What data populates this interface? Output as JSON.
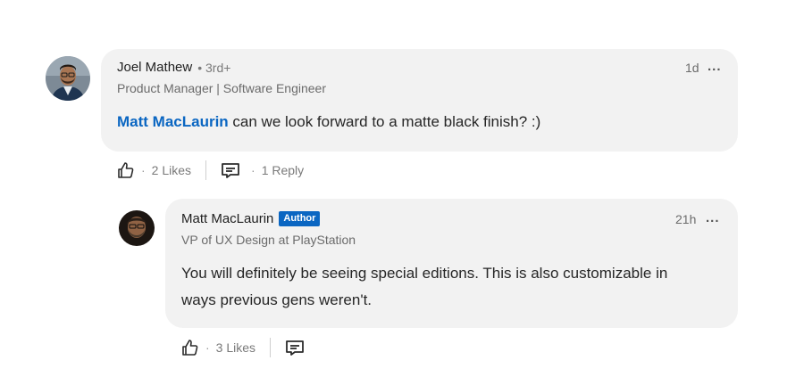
{
  "comment": {
    "author_name": "Joel Mathew",
    "connection_degree": "• 3rd+",
    "headline": "Product Manager | Software Engineer",
    "timestamp": "1d",
    "more_label": "...",
    "mention": "Matt MacLaurin",
    "text": "can we look forward to a matte black finish? :)",
    "like_icon": "thumbs-up-icon",
    "likes": "2 Likes",
    "reply_icon": "comment-reply-icon",
    "replies": "1 Reply",
    "separator_dot": "·"
  },
  "reply": {
    "author_name": "Matt MacLaurin",
    "badge": "Author",
    "headline": "VP of UX Design at PlayStation",
    "timestamp": "21h",
    "more_label": "...",
    "text": "You will definitely be seeing special editions. This is also customizable in ways previous gens weren't.",
    "like_icon": "thumbs-up-icon",
    "likes": "3 Likes",
    "reply_icon": "comment-reply-icon",
    "separator_dot": "·"
  },
  "colors": {
    "bubble": "#f2f2f2",
    "mention": "#0a66c2",
    "badge": "#0a66c2"
  }
}
